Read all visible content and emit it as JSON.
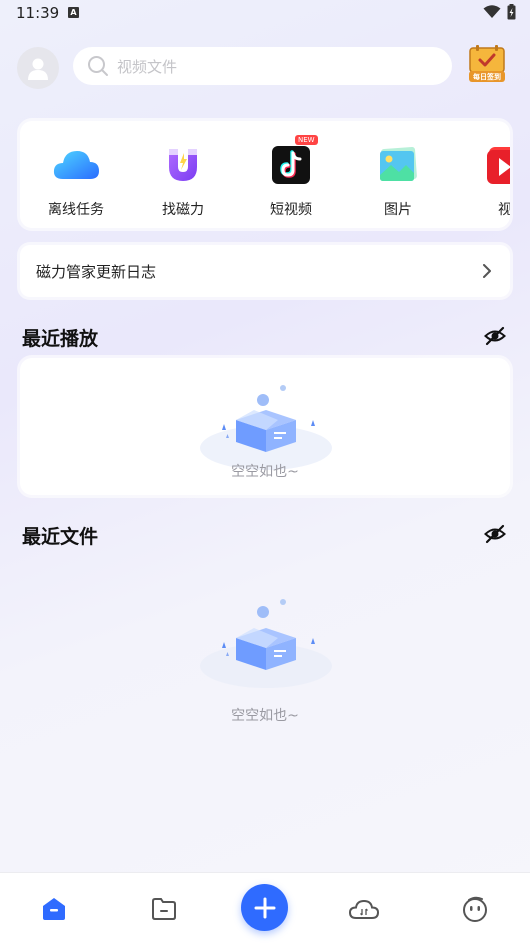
{
  "status_bar": {
    "time": "11:39",
    "indicator": "A"
  },
  "header": {
    "search_placeholder": "视频文件",
    "checkin_label": "每日签到"
  },
  "quick_actions": [
    {
      "label": "离线任务",
      "icon": "cloud-icon"
    },
    {
      "label": "找磁力",
      "icon": "magnet-icon"
    },
    {
      "label": "短视频",
      "icon": "tiktok-icon",
      "badge": "NEW"
    },
    {
      "label": "图片",
      "icon": "image-icon"
    },
    {
      "label": "视",
      "icon": "video-icon"
    }
  ],
  "update_log": {
    "label": "磁力管家更新日志"
  },
  "recent_play": {
    "title": "最近播放",
    "empty_text": "空空如也~"
  },
  "recent_files": {
    "title": "最近文件",
    "empty_text": "空空如也~"
  },
  "colors": {
    "accent": "#2f6bff",
    "nav_active": "#2f6bff"
  },
  "bottom_nav": [
    {
      "name": "home",
      "icon": "home-icon",
      "active": true
    },
    {
      "name": "files",
      "icon": "folder-icon"
    },
    {
      "name": "add",
      "icon": "plus-icon"
    },
    {
      "name": "cloud",
      "icon": "cloud-transfer-icon"
    },
    {
      "name": "profile",
      "icon": "face-icon"
    }
  ]
}
